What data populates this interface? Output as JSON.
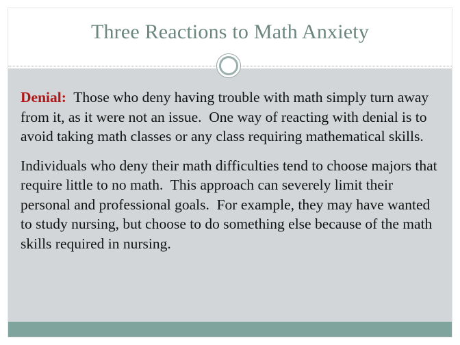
{
  "slide": {
    "title": "Three Reactions to Math Anxiety",
    "paragraph1": {
      "term": "Denial:",
      "text": "  Those who deny having trouble with math simply turn away from it, as it were not an issue.  One way of reacting with denial is to avoid taking math classes or any class requiring mathematical skills."
    },
    "paragraph2": {
      "text": "Individuals who deny their math difficulties tend to choose majors that require little to no math.  This approach can severely limit their personal and professional goals.  For example, they may have wanted to study nursing, but choose to do something else because of the math skills required in nursing."
    }
  },
  "colors": {
    "title": "#6b857f",
    "term": "#b01717",
    "content_background": "#d2d6d8",
    "footer_bar": "#7fa39d"
  }
}
